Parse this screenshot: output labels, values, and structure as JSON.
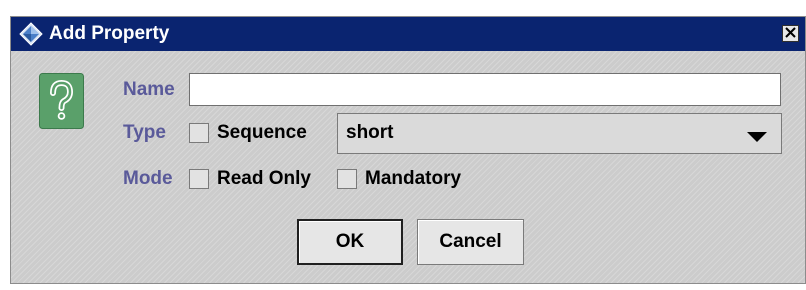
{
  "dialog": {
    "title": "Add Property",
    "title_icon": "diamond-app-icon",
    "close_icon": "close-icon"
  },
  "help_icon": "question-mark-icon",
  "form": {
    "name": {
      "label": "Name",
      "value": ""
    },
    "type": {
      "label": "Type",
      "sequence_label": "Sequence",
      "sequence_checked": false,
      "selected": "short",
      "dropdown_icon": "chevron-down-icon"
    },
    "mode": {
      "label": "Mode",
      "read_only_label": "Read Only",
      "read_only_checked": false,
      "mandatory_label": "Mandatory",
      "mandatory_checked": false
    }
  },
  "buttons": {
    "ok": "OK",
    "cancel": "Cancel"
  },
  "colors": {
    "titlebar": "#0a2470",
    "label": "#5a5a9a",
    "help_icon": "#5aa06a",
    "dialog_bg": "#cccccc"
  }
}
